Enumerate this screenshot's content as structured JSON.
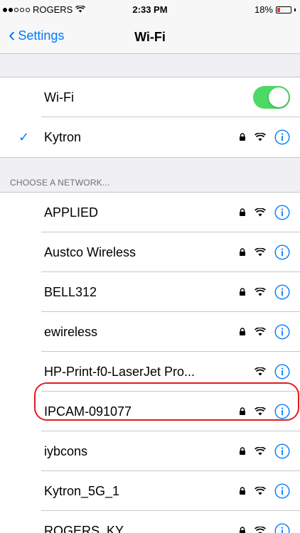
{
  "status_bar": {
    "carrier": "ROGERS",
    "time": "2:33 PM",
    "battery_text": "18%",
    "battery_fraction": 0.18,
    "battery_color": "#ff2d2d"
  },
  "nav": {
    "back_label": "Settings",
    "title": "Wi-Fi"
  },
  "wifi_toggle": {
    "label": "Wi-Fi",
    "on": true,
    "color": "#4cd964"
  },
  "connected": {
    "name": "Kytron",
    "secured": true
  },
  "section_header": "CHOOSE A NETWORK...",
  "networks": [
    {
      "name": "APPLIED",
      "secured": true
    },
    {
      "name": "Austco Wireless",
      "secured": true
    },
    {
      "name": "BELL312",
      "secured": true
    },
    {
      "name": "ewireless",
      "secured": true
    },
    {
      "name": "HP-Print-f0-LaserJet Pro...",
      "secured": false
    },
    {
      "name": "IPCAM-091077",
      "secured": true,
      "highlighted": true
    },
    {
      "name": "iybcons",
      "secured": true
    },
    {
      "name": "Kytron_5G_1",
      "secured": true
    },
    {
      "name": "ROGERS_KY",
      "secured": true
    }
  ],
  "colors": {
    "accent": "#007aff",
    "highlight": "#e31b1b"
  },
  "icons": {
    "lock": "lock-icon",
    "wifi": "wifi-icon",
    "info": "info-icon",
    "check": "checkmark-icon",
    "back": "chevron-left-icon"
  }
}
